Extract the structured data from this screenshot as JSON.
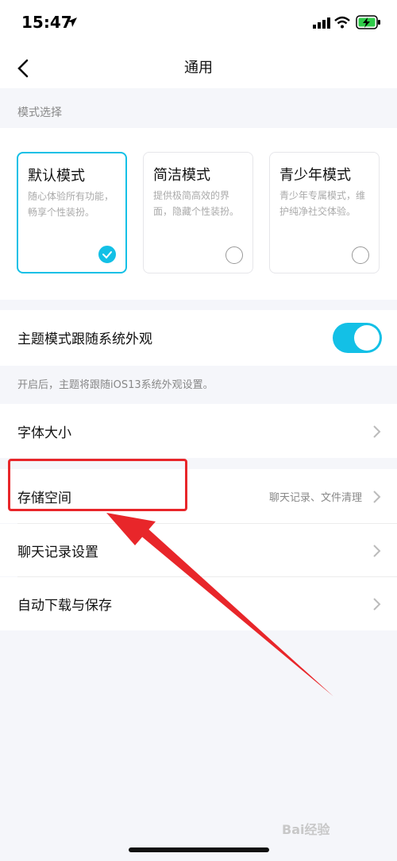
{
  "status_bar": {
    "time": "15:47"
  },
  "nav": {
    "title": "通用"
  },
  "mode_section": {
    "label": "模式选择"
  },
  "modes": [
    {
      "title": "默认模式",
      "desc": "随心体验所有功能，畅享个性装扮。",
      "selected": true
    },
    {
      "title": "简洁模式",
      "desc": "提供极简高效的界面，隐藏个性装扮。",
      "selected": false
    },
    {
      "title": "青少年模式",
      "desc": "青少年专属模式，维护纯净社交体验。",
      "selected": false
    }
  ],
  "theme": {
    "label": "主题模式跟随系统外观",
    "enabled": true,
    "hint": "开启后，主题将跟随iOS13系统外观设置。"
  },
  "font_size": {
    "label": "字体大小"
  },
  "storage": {
    "label": "存储空间",
    "value": "聊天记录、文件清理"
  },
  "chat_settings": {
    "label": "聊天记录设置"
  },
  "auto_download": {
    "label": "自动下载与保存"
  },
  "watermark": {
    "text": "Bai经验"
  },
  "colors": {
    "accent": "#13c0e6",
    "annotation": "#e8262a"
  }
}
